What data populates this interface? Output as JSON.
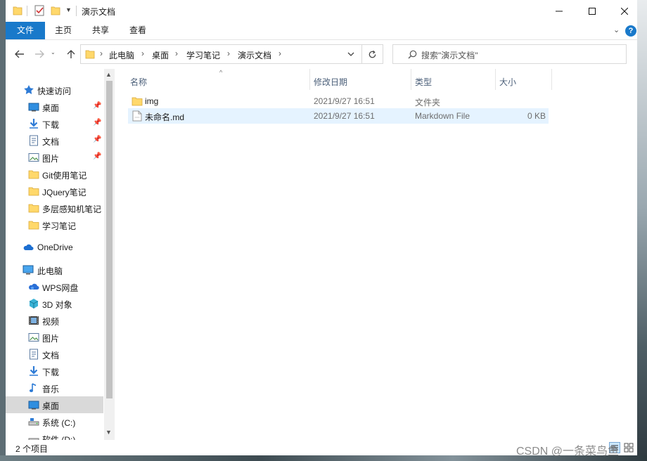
{
  "window": {
    "title": "演示文档",
    "controls": {
      "minimize": "minimize",
      "maximize": "maximize",
      "close": "close"
    }
  },
  "ribbon": {
    "tabs": [
      {
        "label": "文件"
      },
      {
        "label": "主页"
      },
      {
        "label": "共享"
      },
      {
        "label": "查看"
      }
    ]
  },
  "address": {
    "crumbs": [
      "此电脑",
      "桌面",
      "学习笔记",
      "演示文档"
    ],
    "search_placeholder": "搜索\"演示文档\""
  },
  "nav_pane": {
    "quick_access": {
      "label": "快速访问",
      "items": [
        {
          "label": "桌面",
          "icon": "desktop-icon",
          "pinned": true
        },
        {
          "label": "下载",
          "icon": "download-icon",
          "pinned": true
        },
        {
          "label": "文档",
          "icon": "document-icon",
          "pinned": true
        },
        {
          "label": "图片",
          "icon": "picture-icon",
          "pinned": true
        },
        {
          "label": "Git使用笔记",
          "icon": "folder-icon",
          "pinned": false
        },
        {
          "label": "JQuery笔记",
          "icon": "folder-icon",
          "pinned": false
        },
        {
          "label": "多层感知机笔记",
          "icon": "folder-icon",
          "pinned": false
        },
        {
          "label": "学习笔记",
          "icon": "folder-icon",
          "pinned": false
        }
      ]
    },
    "onedrive": {
      "label": "OneDrive"
    },
    "this_pc": {
      "label": "此电脑",
      "items": [
        {
          "label": "WPS网盘",
          "icon": "cloud-icon"
        },
        {
          "label": "3D 对象",
          "icon": "cube-icon"
        },
        {
          "label": "视频",
          "icon": "video-icon"
        },
        {
          "label": "图片",
          "icon": "picture-icon"
        },
        {
          "label": "文档",
          "icon": "document-icon"
        },
        {
          "label": "下载",
          "icon": "download-icon"
        },
        {
          "label": "音乐",
          "icon": "music-icon"
        },
        {
          "label": "桌面",
          "icon": "desktop-icon"
        },
        {
          "label": "系统 (C:)",
          "icon": "drive-icon"
        },
        {
          "label": "软件 (D:)",
          "icon": "drive-icon"
        }
      ]
    }
  },
  "columns": [
    "名称",
    "修改日期",
    "类型",
    "大小"
  ],
  "files": [
    {
      "name": "img",
      "modified": "2021/9/27 16:51",
      "type": "文件夹",
      "size": "",
      "icon": "folder-icon"
    },
    {
      "name": "未命名.md",
      "modified": "2021/9/27 16:51",
      "type": "Markdown File",
      "size": "0 KB",
      "icon": "markdown-file-icon"
    }
  ],
  "status": {
    "count": "2 个项目"
  },
  "watermark": "CSDN @一条菜鸟鱼",
  "colors": {
    "accent": "#1979ca",
    "folder": "#ffd86b",
    "selection": "#cce8ff",
    "hover": "#e5f3ff"
  }
}
